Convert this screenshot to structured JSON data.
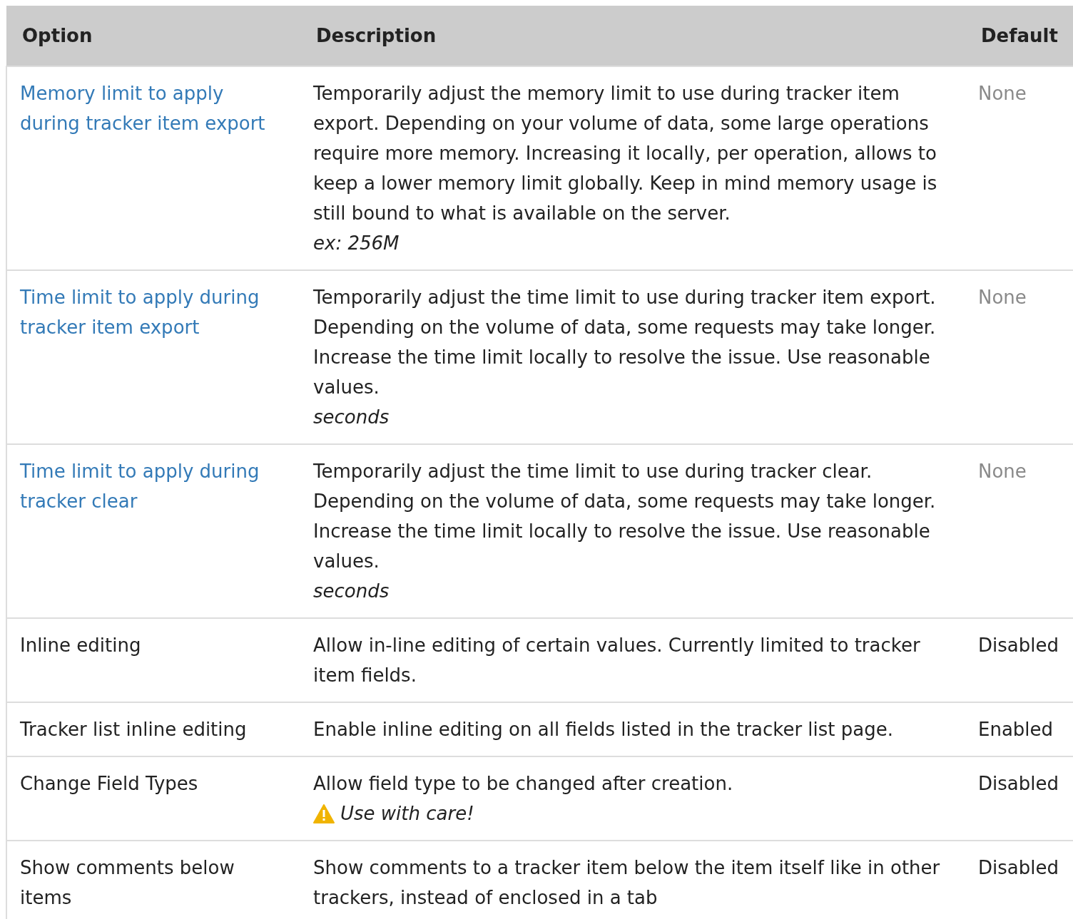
{
  "table": {
    "columns": [
      "Option",
      "Description",
      "Default"
    ],
    "rows": [
      {
        "option": "Memory limit to apply during tracker item export",
        "link": true,
        "description": "Temporarily adjust the memory limit to use during tracker item export. Depending on your volume of data, some large operations require more memory. Increasing it locally, per operation, allows to keep a lower memory limit globally. Keep in mind memory usage is still bound to what is available on the server.",
        "note": "ex: 256M",
        "default": "None",
        "muted": true
      },
      {
        "option": "Time limit to apply during tracker item export",
        "link": true,
        "description": "Temporarily adjust the time limit to use during tracker item export. Depending on the volume of data, some requests may take longer. Increase the time limit locally to resolve the issue. Use reasonable values.",
        "note": "seconds",
        "default": "None",
        "muted": true
      },
      {
        "option": "Time limit to apply during tracker clear",
        "link": true,
        "description": "Temporarily adjust the time limit to use during tracker clear. Depending on the volume of data, some requests may take longer. Increase the time limit locally to resolve the issue. Use reasonable values.",
        "note": "seconds",
        "default": "None",
        "muted": true
      },
      {
        "option": "Inline editing",
        "link": false,
        "description": "Allow in-line editing of certain values. Currently limited to tracker item fields.",
        "default": "Disabled",
        "muted": false
      },
      {
        "option": "Tracker list inline editing",
        "link": false,
        "description": "Enable inline editing on all fields listed in the tracker list page.",
        "default": "Enabled",
        "muted": false
      },
      {
        "option": "Change Field Types",
        "link": false,
        "description": "Allow field type to be changed after creation.",
        "note": "Use with care!",
        "warning": true,
        "default": "Disabled",
        "muted": false
      },
      {
        "option": "Show comments below items",
        "link": false,
        "description": "Show comments to a tracker item below the item itself like in other trackers, instead of enclosed in a tab",
        "default": "Disabled",
        "muted": false
      }
    ]
  }
}
